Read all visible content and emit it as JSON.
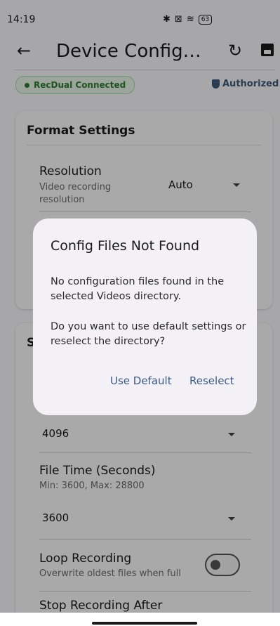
{
  "status_bar": {
    "time": "14:19",
    "battery": "63"
  },
  "app_bar": {
    "back": "←",
    "title": "Device Configurat…",
    "refresh": "↻"
  },
  "connection": {
    "chip_label": "RecDual Connected",
    "authorized_label": "Authorized"
  },
  "format_settings": {
    "title": "Format Settings",
    "resolution": {
      "label": "Resolution",
      "description": "Video recording resolution",
      "value": "Auto"
    }
  },
  "storage_settings": {
    "title_partial": "S",
    "size_value": "4096",
    "file_time": {
      "label": "File Time (Seconds)",
      "hint": "Min: 3600, Max: 28800",
      "value": "3600"
    },
    "loop_recording": {
      "label": "Loop Recording",
      "description": "Overwrite oldest files when full",
      "enabled": false
    },
    "stop_recording_after": {
      "label": "Stop Recording After"
    }
  },
  "dialog": {
    "title": "Config Files Not Found",
    "message_1": "No configuration files found in the selected Videos directory.",
    "message_2": "Do you want to use default settings or reselect the directory?",
    "use_default": "Use Default",
    "reselect": "Reselect"
  },
  "colors": {
    "accent": "#3b5b86",
    "connected": "#2e7d32"
  }
}
